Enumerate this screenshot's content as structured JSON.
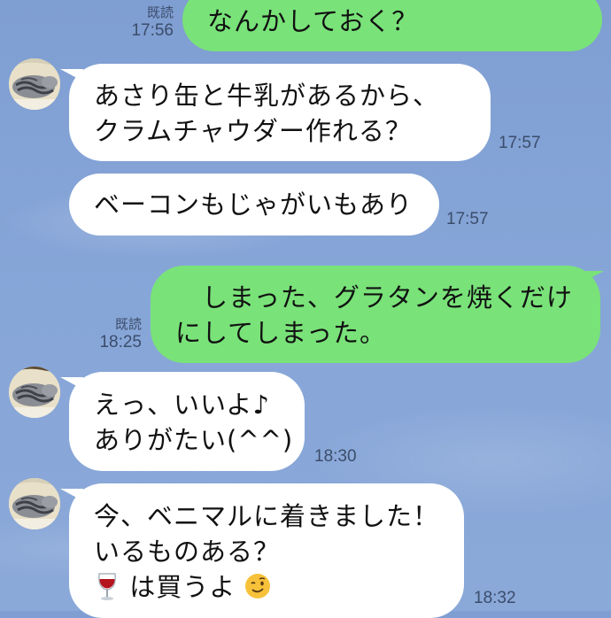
{
  "messages": [
    {
      "id": "m1",
      "side": "out",
      "lines": [
        "なんかしておく？"
      ],
      "read": "既読",
      "time": "17:56"
    },
    {
      "id": "m2",
      "side": "in",
      "lines": [
        "あさり缶と牛乳があるから、",
        "クラムチャウダー作れる？"
      ],
      "time": "17:57"
    },
    {
      "id": "m3",
      "side": "in",
      "lines": [
        "ベーコンもじゃがいもあり"
      ],
      "time": "17:57"
    },
    {
      "id": "m4",
      "side": "out",
      "lines": [
        "　しまった、グラタンを焼くだけ",
        "にしてしまった。"
      ],
      "read": "既読",
      "time": "18:25"
    },
    {
      "id": "m5",
      "side": "in",
      "lines": [
        "えっ、いいよ♪",
        "ありがたい(^^)"
      ],
      "time": "18:30"
    },
    {
      "id": "m6",
      "side": "in",
      "lines": [
        "今、ベニマルに着きました！",
        "いるものある？",
        "は買うよ"
      ],
      "emojis": [
        "wine-glass",
        "winking-face"
      ],
      "time": "18:32"
    }
  ],
  "colors": {
    "out_bubble": "#79e279",
    "in_bubble": "#ffffff",
    "background": "#87a6d8",
    "meta_text": "#3b4d6b"
  }
}
